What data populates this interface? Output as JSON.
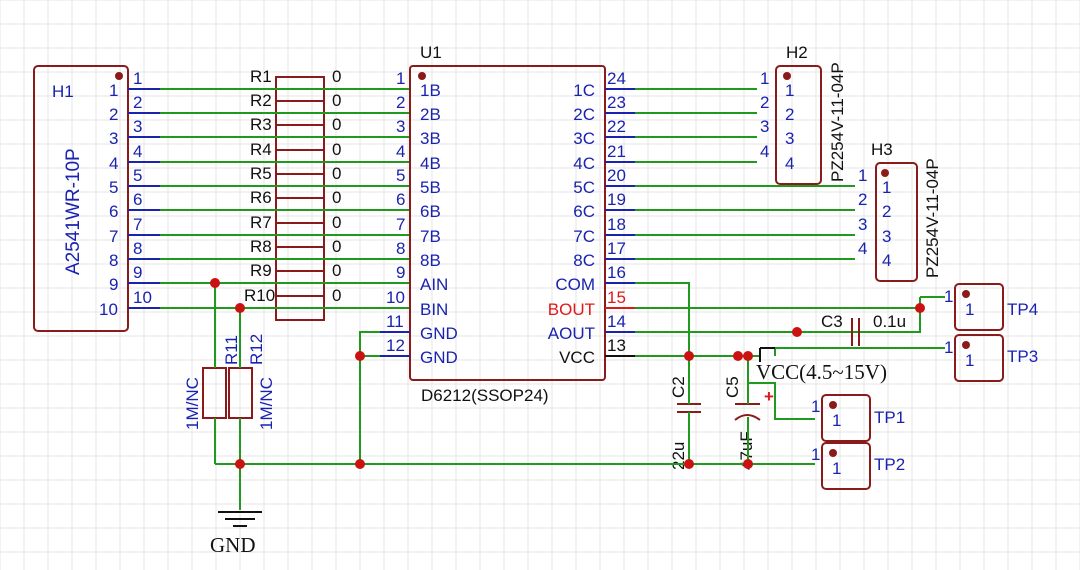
{
  "h1": {
    "ref": "H1",
    "part": "A2541WR-10P",
    "pins": [
      "1",
      "2",
      "3",
      "4",
      "5",
      "6",
      "7",
      "8",
      "9",
      "10"
    ],
    "pin_nums": [
      "1",
      "2",
      "3",
      "4",
      "5",
      "6",
      "7",
      "8",
      "9",
      "10"
    ]
  },
  "resistors": [
    {
      "ref": "R1",
      "value": "0"
    },
    {
      "ref": "R2",
      "value": "0"
    },
    {
      "ref": "R3",
      "value": "0"
    },
    {
      "ref": "R4",
      "value": "0"
    },
    {
      "ref": "R5",
      "value": "0"
    },
    {
      "ref": "R6",
      "value": "0"
    },
    {
      "ref": "R7",
      "value": "0"
    },
    {
      "ref": "R8",
      "value": "0"
    },
    {
      "ref": "R9",
      "value": "0"
    },
    {
      "ref": "R10",
      "value": "0"
    }
  ],
  "r11": {
    "ref": "R11",
    "value": "1M/NC"
  },
  "r12": {
    "ref": "R12",
    "value": "1M/NC"
  },
  "u1": {
    "ref": "U1",
    "part": "D6212(SSOP24)",
    "left_pins": [
      {
        "num": "1",
        "label": "1B"
      },
      {
        "num": "2",
        "label": "2B"
      },
      {
        "num": "3",
        "label": "3B"
      },
      {
        "num": "4",
        "label": "4B"
      },
      {
        "num": "5",
        "label": "5B"
      },
      {
        "num": "6",
        "label": "6B"
      },
      {
        "num": "7",
        "label": "7B"
      },
      {
        "num": "8",
        "label": "8B"
      },
      {
        "num": "9",
        "label": "AIN"
      },
      {
        "num": "10",
        "label": "BIN"
      },
      {
        "num": "11",
        "label": "GND"
      },
      {
        "num": "12",
        "label": "GND"
      }
    ],
    "right_pins": [
      {
        "num": "24",
        "label": "1C"
      },
      {
        "num": "23",
        "label": "2C"
      },
      {
        "num": "22",
        "label": "3C"
      },
      {
        "num": "21",
        "label": "4C"
      },
      {
        "num": "20",
        "label": "5C"
      },
      {
        "num": "19",
        "label": "6C"
      },
      {
        "num": "18",
        "label": "7C"
      },
      {
        "num": "17",
        "label": "8C"
      },
      {
        "num": "16",
        "label": "COM"
      },
      {
        "num": "15",
        "label": "BOUT"
      },
      {
        "num": "14",
        "label": "AOUT"
      },
      {
        "num": "13",
        "label": "VCC"
      }
    ]
  },
  "h2": {
    "ref": "H2",
    "part": "PZ254V-11-04P",
    "pins": [
      "1",
      "2",
      "3",
      "4"
    ],
    "pin_nums": [
      "1",
      "2",
      "3",
      "4"
    ]
  },
  "h3": {
    "ref": "H3",
    "part": "PZ254V-11-04P",
    "pins": [
      "1",
      "2",
      "3",
      "4"
    ],
    "pin_nums": [
      "1",
      "2",
      "3",
      "4"
    ]
  },
  "c2": {
    "ref": "C2",
    "value": "22u"
  },
  "c5": {
    "ref": "C5",
    "value": "47uF",
    "polarity": "+"
  },
  "c3": {
    "ref": "C3",
    "value": "0.1u"
  },
  "tp1": {
    "ref": "TP1",
    "pin": "1",
    "pin_num": "1"
  },
  "tp2": {
    "ref": "TP2",
    "pin": "1",
    "pin_num": "1"
  },
  "tp3": {
    "ref": "TP3",
    "pin": "1",
    "pin_num": "1"
  },
  "tp4": {
    "ref": "TP4",
    "pin": "1",
    "pin_num": "1"
  },
  "vcc_label": "VCC(4.5~15V)",
  "gnd_label": "GND"
}
